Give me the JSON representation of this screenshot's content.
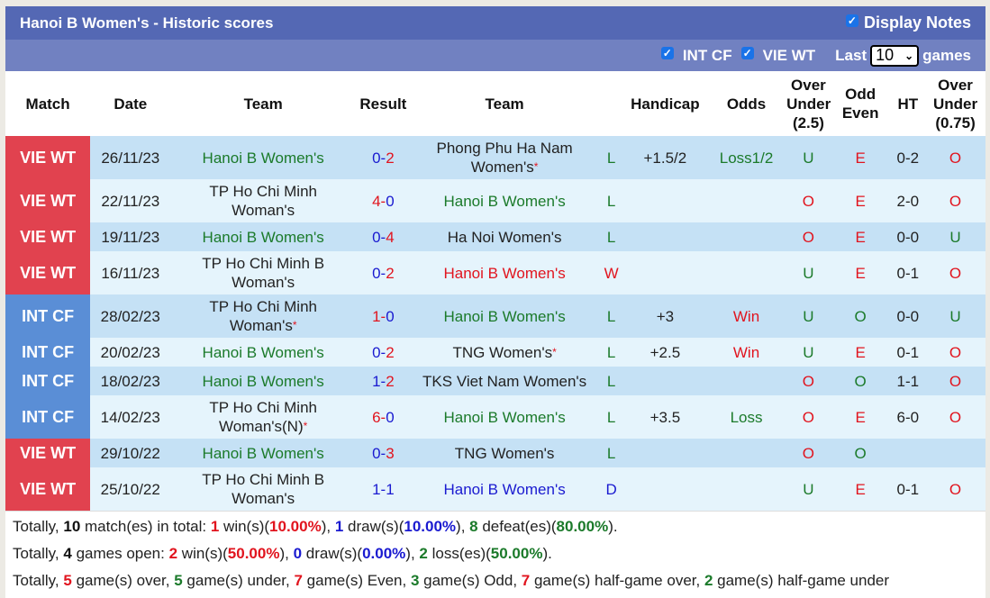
{
  "header": {
    "title": "Hanoi B Women's - Historic scores",
    "display_notes_label": "Display Notes",
    "display_notes_checked": true
  },
  "filters": {
    "competitions": [
      {
        "label": "INT CF",
        "checked": true
      },
      {
        "label": "VIE WT",
        "checked": true
      }
    ],
    "last_label": "Last",
    "last_value": "10",
    "games_label": "games"
  },
  "columns": {
    "match": "Match",
    "date": "Date",
    "team_home": "Team",
    "result": "Result",
    "team_away": "Team",
    "handicap": "Handicap",
    "odds": "Odds",
    "ou25_line1": "Over",
    "ou25_line2": "Under",
    "ou25_line3": "(2.5)",
    "oe_line1": "Odd",
    "oe_line2": "Even",
    "ht": "HT",
    "ou075_line1": "Over",
    "ou075_line2": "Under",
    "ou075_line3": "(0.75)"
  },
  "colors": {
    "vie_wt": "#e1424f",
    "int_cf": "#5a8ed6",
    "win": "#e1141e",
    "loss": "#1b7a2a",
    "draw": "#1a1ad0",
    "header_bar": "#5468b4",
    "filter_bar": "#7181c1"
  },
  "rows": [
    {
      "match": "VIE WT",
      "type": "vie",
      "date": "26/11/23",
      "home": "Hanoi B Women's",
      "home_color": "green",
      "home_star": false,
      "home_line2": "",
      "hg": "0",
      "ag": "2",
      "hg_color": "blue",
      "ag_color": "red",
      "away": "Phong Phu Ha Nam",
      "away_line2": "Women's",
      "away_color": "dark",
      "away_star": true,
      "wl": "L",
      "wl_color": "green",
      "handicap": "+1.5/2",
      "odds": "Loss1/2",
      "odds_color": "green",
      "ou": "U",
      "ou_color": "green",
      "oe": "E",
      "oe_color": "red",
      "ht": "0-2",
      "ou075": "O",
      "ou075_color": "red"
    },
    {
      "match": "VIE WT",
      "type": "vie",
      "date": "22/11/23",
      "home": "TP Ho Chi Minh",
      "home_line2": "Woman's",
      "home_color": "dark",
      "home_star": false,
      "hg": "4",
      "ag": "0",
      "hg_color": "red",
      "ag_color": "blue",
      "away": "Hanoi B Women's",
      "away_line2": "",
      "away_color": "green",
      "away_star": false,
      "wl": "L",
      "wl_color": "green",
      "handicap": "",
      "odds": "",
      "odds_color": "dark",
      "ou": "O",
      "ou_color": "red",
      "oe": "E",
      "oe_color": "red",
      "ht": "2-0",
      "ou075": "O",
      "ou075_color": "red"
    },
    {
      "match": "VIE WT",
      "type": "vie",
      "date": "19/11/23",
      "home": "Hanoi B Women's",
      "home_line2": "",
      "home_color": "green",
      "home_star": false,
      "hg": "0",
      "ag": "4",
      "hg_color": "blue",
      "ag_color": "red",
      "away": "Ha Noi Women's",
      "away_line2": "",
      "away_color": "dark",
      "away_star": false,
      "wl": "L",
      "wl_color": "green",
      "handicap": "",
      "odds": "",
      "odds_color": "dark",
      "ou": "O",
      "ou_color": "red",
      "oe": "E",
      "oe_color": "red",
      "ht": "0-0",
      "ou075": "U",
      "ou075_color": "green"
    },
    {
      "match": "VIE WT",
      "type": "vie",
      "date": "16/11/23",
      "home": "TP Ho Chi Minh B",
      "home_line2": "Woman's",
      "home_color": "dark",
      "home_star": false,
      "hg": "0",
      "ag": "2",
      "hg_color": "blue",
      "ag_color": "red",
      "away": "Hanoi B Women's",
      "away_line2": "",
      "away_color": "red",
      "away_star": false,
      "wl": "W",
      "wl_color": "red",
      "handicap": "",
      "odds": "",
      "odds_color": "dark",
      "ou": "U",
      "ou_color": "green",
      "oe": "E",
      "oe_color": "red",
      "ht": "0-1",
      "ou075": "O",
      "ou075_color": "red"
    },
    {
      "match": "INT CF",
      "type": "int",
      "date": "28/02/23",
      "home": "TP Ho Chi Minh",
      "home_line2": "Woman's",
      "home_color": "dark",
      "home_star": true,
      "hg": "1",
      "ag": "0",
      "hg_color": "red",
      "ag_color": "blue",
      "away": "Hanoi B Women's",
      "away_line2": "",
      "away_color": "green",
      "away_star": false,
      "wl": "L",
      "wl_color": "green",
      "handicap": "+3",
      "odds": "Win",
      "odds_color": "red",
      "ou": "U",
      "ou_color": "green",
      "oe": "O",
      "oe_color": "green",
      "ht": "0-0",
      "ou075": "U",
      "ou075_color": "green"
    },
    {
      "match": "INT CF",
      "type": "int",
      "date": "20/02/23",
      "home": "Hanoi B Women's",
      "home_line2": "",
      "home_color": "green",
      "home_star": false,
      "hg": "0",
      "ag": "2",
      "hg_color": "blue",
      "ag_color": "red",
      "away": "TNG Women's",
      "away_line2": "",
      "away_color": "dark",
      "away_star": true,
      "wl": "L",
      "wl_color": "green",
      "handicap": "+2.5",
      "odds": "Win",
      "odds_color": "red",
      "ou": "U",
      "ou_color": "green",
      "oe": "E",
      "oe_color": "red",
      "ht": "0-1",
      "ou075": "O",
      "ou075_color": "red"
    },
    {
      "match": "INT CF",
      "type": "int",
      "date": "18/02/23",
      "home": "Hanoi B Women's",
      "home_line2": "",
      "home_color": "green",
      "home_star": false,
      "hg": "1",
      "ag": "2",
      "hg_color": "blue",
      "ag_color": "red",
      "away": "TKS Viet Nam Women's",
      "away_line2": "",
      "away_color": "dark",
      "away_star": false,
      "wl": "L",
      "wl_color": "green",
      "handicap": "",
      "odds": "",
      "odds_color": "dark",
      "ou": "O",
      "ou_color": "red",
      "oe": "O",
      "oe_color": "green",
      "ht": "1-1",
      "ou075": "O",
      "ou075_color": "red"
    },
    {
      "match": "INT CF",
      "type": "int",
      "date": "14/02/23",
      "home": "TP Ho Chi Minh",
      "home_line2": "Woman's(N)",
      "home_color": "dark",
      "home_star": true,
      "hg": "6",
      "ag": "0",
      "hg_color": "red",
      "ag_color": "blue",
      "away": "Hanoi B Women's",
      "away_line2": "",
      "away_color": "green",
      "away_star": false,
      "wl": "L",
      "wl_color": "green",
      "handicap": "+3.5",
      "odds": "Loss",
      "odds_color": "green",
      "ou": "O",
      "ou_color": "red",
      "oe": "E",
      "oe_color": "red",
      "ht": "6-0",
      "ou075": "O",
      "ou075_color": "red"
    },
    {
      "match": "VIE WT",
      "type": "vie",
      "date": "29/10/22",
      "home": "Hanoi B Women's",
      "home_line2": "",
      "home_color": "green",
      "home_star": false,
      "hg": "0",
      "ag": "3",
      "hg_color": "blue",
      "ag_color": "red",
      "away": "TNG Women's",
      "away_line2": "",
      "away_color": "dark",
      "away_star": false,
      "wl": "L",
      "wl_color": "green",
      "handicap": "",
      "odds": "",
      "odds_color": "dark",
      "ou": "O",
      "ou_color": "red",
      "oe": "O",
      "oe_color": "green",
      "ht": "",
      "ou075": "",
      "ou075_color": "dark"
    },
    {
      "match": "VIE WT",
      "type": "vie",
      "date": "25/10/22",
      "home": "TP Ho Chi Minh B",
      "home_line2": "Woman's",
      "home_color": "dark",
      "home_star": false,
      "hg": "1",
      "ag": "1",
      "hg_color": "blue",
      "ag_color": "blue",
      "away": "Hanoi B Women's",
      "away_line2": "",
      "away_color": "blue",
      "away_star": false,
      "wl": "D",
      "wl_color": "blue",
      "handicap": "",
      "odds": "",
      "odds_color": "dark",
      "ou": "U",
      "ou_color": "green",
      "oe": "E",
      "oe_color": "red",
      "ht": "0-1",
      "ou075": "O",
      "ou075_color": "red"
    }
  ],
  "summary": {
    "line1": [
      {
        "t": "Totally, "
      },
      {
        "b": "10",
        "c": "dark"
      },
      {
        "t": " match(es) in total: "
      },
      {
        "b": "1",
        "c": "red"
      },
      {
        "t": " win(s)("
      },
      {
        "b": "10.00%",
        "c": "red"
      },
      {
        "t": "), "
      },
      {
        "b": "1",
        "c": "blue"
      },
      {
        "t": " draw(s)("
      },
      {
        "b": "10.00%",
        "c": "blue"
      },
      {
        "t": "), "
      },
      {
        "b": "8",
        "c": "green"
      },
      {
        "t": " defeat(es)("
      },
      {
        "b": "80.00%",
        "c": "green"
      },
      {
        "t": ")."
      }
    ],
    "line2": [
      {
        "t": "Totally, "
      },
      {
        "b": "4",
        "c": "dark"
      },
      {
        "t": " games open: "
      },
      {
        "b": "2",
        "c": "red"
      },
      {
        "t": " win(s)("
      },
      {
        "b": "50.00%",
        "c": "red"
      },
      {
        "t": "), "
      },
      {
        "b": "0",
        "c": "blue"
      },
      {
        "t": " draw(s)("
      },
      {
        "b": "0.00%",
        "c": "blue"
      },
      {
        "t": "), "
      },
      {
        "b": "2",
        "c": "green"
      },
      {
        "t": " loss(es)("
      },
      {
        "b": "50.00%",
        "c": "green"
      },
      {
        "t": ")."
      }
    ],
    "line3": [
      {
        "t": "Totally, "
      },
      {
        "b": "5",
        "c": "red"
      },
      {
        "t": " game(s) over, "
      },
      {
        "b": "5",
        "c": "green"
      },
      {
        "t": " game(s) under, "
      },
      {
        "b": "7",
        "c": "red"
      },
      {
        "t": " game(s) Even, "
      },
      {
        "b": "3",
        "c": "green"
      },
      {
        "t": " game(s) Odd, "
      },
      {
        "b": "7",
        "c": "red"
      },
      {
        "t": " game(s) half-game over, "
      },
      {
        "b": "2",
        "c": "green"
      },
      {
        "t": " game(s) half-game under"
      }
    ]
  }
}
